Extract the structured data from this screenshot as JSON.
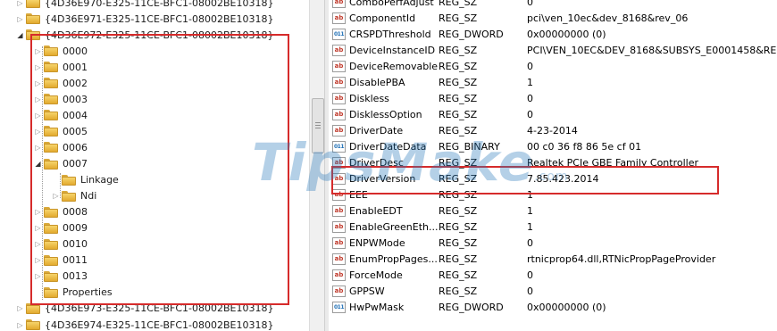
{
  "tree": {
    "items": [
      {
        "label": "{4D36E970-E325-11CE-BFC1-08002BE10318}",
        "depth": 0,
        "state": "collapsed"
      },
      {
        "label": "{4D36E971-E325-11CE-BFC1-08002BE10318}",
        "depth": 0,
        "state": "collapsed"
      },
      {
        "label": "{4D36E972-E325-11CE-BFC1-08002BE10318}",
        "depth": 0,
        "state": "expanded"
      },
      {
        "label": "0000",
        "depth": 1,
        "state": "collapsed"
      },
      {
        "label": "0001",
        "depth": 1,
        "state": "collapsed"
      },
      {
        "label": "0002",
        "depth": 1,
        "state": "collapsed"
      },
      {
        "label": "0003",
        "depth": 1,
        "state": "collapsed"
      },
      {
        "label": "0004",
        "depth": 1,
        "state": "collapsed"
      },
      {
        "label": "0005",
        "depth": 1,
        "state": "collapsed"
      },
      {
        "label": "0006",
        "depth": 1,
        "state": "collapsed"
      },
      {
        "label": "0007",
        "depth": 1,
        "state": "expanded"
      },
      {
        "label": "Linkage",
        "depth": 2,
        "state": "leaf"
      },
      {
        "label": "Ndi",
        "depth": 2,
        "state": "collapsed"
      },
      {
        "label": "0008",
        "depth": 1,
        "state": "collapsed"
      },
      {
        "label": "0009",
        "depth": 1,
        "state": "collapsed"
      },
      {
        "label": "0010",
        "depth": 1,
        "state": "collapsed"
      },
      {
        "label": "0011",
        "depth": 1,
        "state": "collapsed"
      },
      {
        "label": "0013",
        "depth": 1,
        "state": "collapsed"
      },
      {
        "label": "Properties",
        "depth": 1,
        "state": "leaf"
      },
      {
        "label": "{4D36E973-E325-11CE-BFC1-08002BE10318}",
        "depth": 0,
        "state": "collapsed"
      },
      {
        "label": "{4D36E974-E325-11CE-BFC1-08002BE10318}",
        "depth": 0,
        "state": "collapsed"
      }
    ]
  },
  "values": {
    "rows": [
      {
        "icon": "string-value-icon",
        "badge": "ab",
        "name": "ComboPerfAdjust",
        "type": "REG_SZ",
        "data": "0"
      },
      {
        "icon": "string-value-icon",
        "badge": "ab",
        "name": "ComponentId",
        "type": "REG_SZ",
        "data": "pci\\ven_10ec&dev_8168&rev_06"
      },
      {
        "icon": "binary-value-icon",
        "badge": "011",
        "name": "CRSPDThreshold",
        "type": "REG_DWORD",
        "data": "0x00000000 (0)"
      },
      {
        "icon": "string-value-icon",
        "badge": "ab",
        "name": "DeviceInstanceID",
        "type": "REG_SZ",
        "data": "PCI\\VEN_10EC&DEV_8168&SUBSYS_E0001458&RE.."
      },
      {
        "icon": "string-value-icon",
        "badge": "ab",
        "name": "DeviceRemovable",
        "type": "REG_SZ",
        "data": "0"
      },
      {
        "icon": "string-value-icon",
        "badge": "ab",
        "name": "DisablePBA",
        "type": "REG_SZ",
        "data": "1"
      },
      {
        "icon": "string-value-icon",
        "badge": "ab",
        "name": "Diskless",
        "type": "REG_SZ",
        "data": "0"
      },
      {
        "icon": "string-value-icon",
        "badge": "ab",
        "name": "DisklessOption",
        "type": "REG_SZ",
        "data": "0"
      },
      {
        "icon": "string-value-icon",
        "badge": "ab",
        "name": "DriverDate",
        "type": "REG_SZ",
        "data": "4-23-2014"
      },
      {
        "icon": "binary-value-icon",
        "badge": "011",
        "name": "DriverDateData",
        "type": "REG_BINARY",
        "data": "00 c0 36 f8 86 5e cf 01"
      },
      {
        "icon": "string-value-icon",
        "badge": "ab",
        "name": "DriverDesc",
        "type": "REG_SZ",
        "data": "Realtek PCIe GBE Family Controller"
      },
      {
        "icon": "string-value-icon",
        "badge": "ab",
        "name": "DriverVersion",
        "type": "REG_SZ",
        "data": "7.85.423.2014"
      },
      {
        "icon": "string-value-icon",
        "badge": "ab",
        "name": "EEE",
        "type": "REG_SZ",
        "data": "1"
      },
      {
        "icon": "string-value-icon",
        "badge": "ab",
        "name": "EnableEDT",
        "type": "REG_SZ",
        "data": "1"
      },
      {
        "icon": "string-value-icon",
        "badge": "ab",
        "name": "EnableGreenEth...",
        "type": "REG_SZ",
        "data": "1"
      },
      {
        "icon": "string-value-icon",
        "badge": "ab",
        "name": "ENPWMode",
        "type": "REG_SZ",
        "data": "0"
      },
      {
        "icon": "string-value-icon",
        "badge": "ab",
        "name": "EnumPropPages...",
        "type": "REG_SZ",
        "data": "rtnicprop64.dll,RTNicPropPageProvider"
      },
      {
        "icon": "string-value-icon",
        "badge": "ab",
        "name": "ForceMode",
        "type": "REG_SZ",
        "data": "0"
      },
      {
        "icon": "string-value-icon",
        "badge": "ab",
        "name": "GPPSW",
        "type": "REG_SZ",
        "data": "0"
      },
      {
        "icon": "binary-value-icon",
        "badge": "011",
        "name": "HwPwMask",
        "type": "REG_DWORD",
        "data": "0x00000000 (0)"
      }
    ]
  },
  "watermark": {
    "text": "TipsMake",
    "suffix": ".com"
  },
  "colors": {
    "highlight": "#d62b2b",
    "folder": "#f0c14b",
    "string_badge": "#c0392b",
    "binary_badge": "#1f6fb5"
  }
}
